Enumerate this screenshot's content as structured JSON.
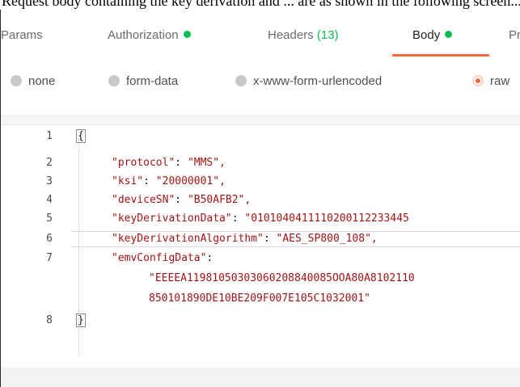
{
  "caption": "Request body containing the key derivation and ... are as shown in the following screen...",
  "tabs": {
    "params": "Params",
    "authorization": "Authorization",
    "headers": "Headers",
    "headers_count": "(13)",
    "body": "Body",
    "pre_request": "Pr"
  },
  "body_types": {
    "none": "none",
    "form_data": "form-data",
    "urlencoded": "x-www-form-urlencoded",
    "raw": "raw",
    "selected": "raw"
  },
  "colors": {
    "accent": "#f26b3a",
    "status_green": "#0cbb52",
    "string_red": "#a31515"
  },
  "editor": {
    "lines": [
      {
        "num": "1",
        "text": "{"
      },
      {
        "num": "2",
        "key": "\"protocol\"",
        "value": "\"MMS\","
      },
      {
        "num": "3",
        "key": "\"ksi\"",
        "value": "\"20000001\","
      },
      {
        "num": "4",
        "key": "\"deviceSN\"",
        "value": "\"B50AFB2\","
      },
      {
        "num": "5",
        "key": "\"keyDerivationData\"",
        "value": "\"0101040411110200112233445"
      },
      {
        "num": "6",
        "key": "\"keyDerivationAlgorithm\"",
        "value": "\"AES_SP800_108\","
      },
      {
        "num": "7",
        "key": "\"emvConfigData\"",
        "value": ""
      },
      {
        "num": "",
        "cont": "\"EEEEA11981050303060208840085OOA80A8102110"
      },
      {
        "num": "",
        "cont": "850101890DE10BE209F007E105C1032001\""
      },
      {
        "num": "8",
        "text": "}"
      }
    ]
  }
}
